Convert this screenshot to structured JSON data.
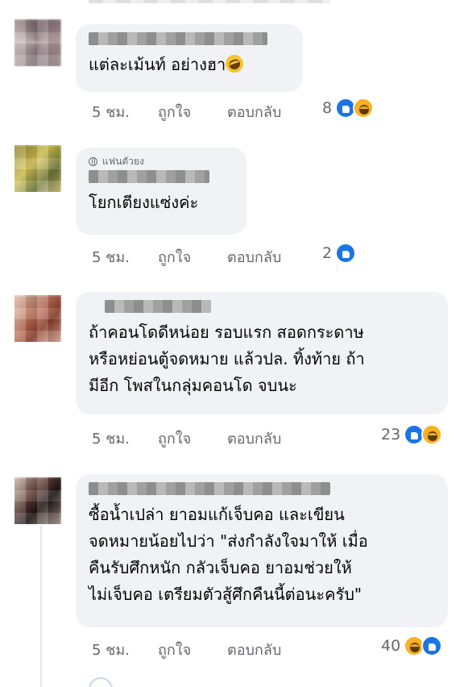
{
  "colors": {
    "bubble": "#f0f2f5",
    "meta_text": "#65676b",
    "like_blue": "#1b74e4",
    "haha_yellow": "#f7b125"
  },
  "comments": [
    {
      "text": "แต่ละเม้นท์ อย่างฮา",
      "trailing_emoji": "rolling-on-floor-laughing-emoji",
      "time": "5 ชม.",
      "like_label": "ถูกใจ",
      "reply_label": "ตอบกลับ",
      "reaction_count": "8",
      "reactions": [
        "like",
        "haha"
      ]
    },
    {
      "tag": "แฟนตัวยง",
      "text": "โยกเตียงแซ่งค่ะ",
      "time": "5 ชม.",
      "like_label": "ถูกใจ",
      "reply_label": "ตอบกลับ",
      "reaction_count": "2",
      "reactions": [
        "like"
      ]
    },
    {
      "text": "ถ้าคอนโดดีหน่อย รอบแรก สอดกระดาษ\nหรือหย่อนตู้จดหมาย แล้วปล. ทิ้งท้าย ถ้า\nมีอีก โพสในกลุ่มคอนโด จบนะ",
      "time": "5 ชม.",
      "like_label": "ถูกใจ",
      "reply_label": "ตอบกลับ",
      "reaction_count": "23",
      "reactions": [
        "like",
        "haha"
      ]
    },
    {
      "text": "ซื้อน้ำเปล่า ยาอมแก้เจ็บคอ และเขียน\nจดหมายน้อยไปว่า \"ส่งกำลังใจมาให้ เมื่อ\nคืนรับศึกหนัก กลัวเจ็บคอ ยาอมช่วยให้\nไม่เจ็บคอ เตรียมตัวสู้ศึกคืนนี้ต่อนะครับ\"",
      "time": "5 ชม.",
      "like_label": "ถูกใจ",
      "reply_label": "ตอบกลับ",
      "reaction_count": "40",
      "reactions": [
        "haha",
        "like"
      ]
    }
  ]
}
